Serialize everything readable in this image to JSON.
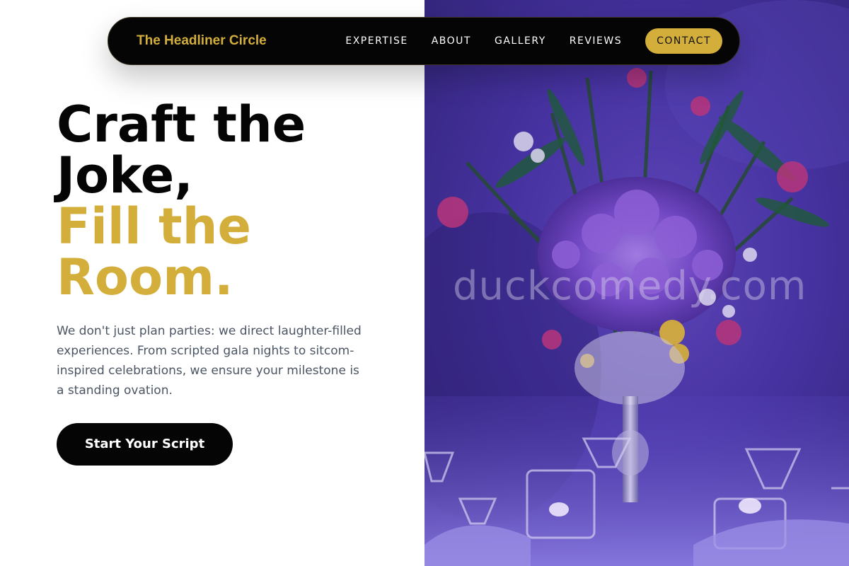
{
  "nav": {
    "brand": "The Headliner Circle",
    "links": [
      "EXPERTISE",
      "ABOUT",
      "GALLERY",
      "REVIEWS"
    ],
    "cta": "CONTACT"
  },
  "hero": {
    "headline_lines": [
      "Craft the",
      "Joke,"
    ],
    "headline_accent_lines": [
      "Fill the",
      "Room."
    ],
    "intro": "We don't just plan parties: we direct laughter-filled experiences. From scripted gala nights to sitcom-inspired celebrations, we ensure your milestone is a standing ovation.",
    "button": "Start Your Script"
  },
  "photo": {
    "watermark": "duckcomedy.com"
  },
  "colors": {
    "accent_gold": "#d4ae3a",
    "nav_background": "#050505",
    "body_text": "#4b5563",
    "photo_purple": "#4a35a8"
  },
  "icons": []
}
